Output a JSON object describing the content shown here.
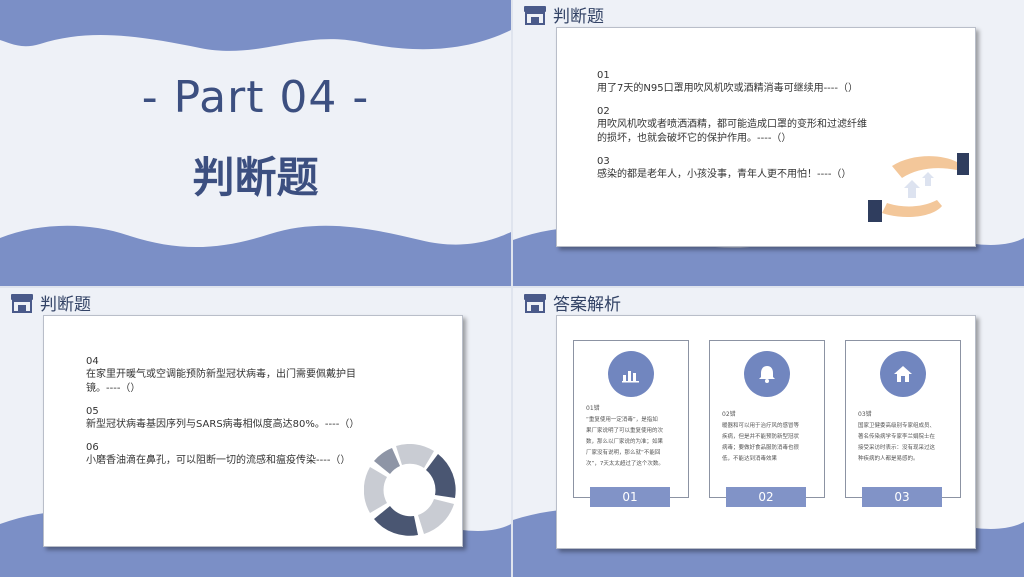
{
  "slide1": {
    "part": "- Part 04 -",
    "title": "判断题"
  },
  "slide2": {
    "header": "判断题",
    "items": [
      {
        "num": "01",
        "text": "用了7天的N95口罩用吹风机吹或酒精消毒可继续用----（）"
      },
      {
        "num": "02",
        "text": "用吹风机吹或者喷洒酒精，都可能造成口罩的变形和过滤纤维",
        "text2": "的损坏，也就会破坏它的保护作用。----（）"
      },
      {
        "num": "03",
        "text": "感染的都是老年人，小孩没事，青年人更不用怕！----（）"
      }
    ]
  },
  "slide3": {
    "header": "判断题",
    "items": [
      {
        "num": "04",
        "text": "在家里开暖气或空调能预防新型冠状病毒，出门需要佩戴护目",
        "text2": "镜。----（）"
      },
      {
        "num": "05",
        "text": "新型冠状病毒基因序列与SARS病毒相似度高达80%。----（）"
      },
      {
        "num": "06",
        "text": "小磨香油滴在鼻孔，可以阻断一切的流感和瘟疫传染----（）"
      }
    ]
  },
  "slide4": {
    "header": "答案解析",
    "columns": [
      {
        "label": "01错",
        "lines": [
          "“重复使用一定消毒”，是指如",
          "果厂家说明了可以重复使用的次",
          "数，那么以厂家说的为准；如果",
          "厂家没有说明，那么就“不能回",
          "次”，7天太太超过了这个次数。"
        ],
        "button": "01"
      },
      {
        "label": "02错",
        "lines": [
          "暖器和可以用于治疗风的感冒等",
          "疾病，但是并不能预防新型冠状",
          "病毒；要做好食品服防消毒也很",
          "低，不能达到消毒效果"
        ],
        "button": "02"
      },
      {
        "label": "03错",
        "lines": [
          "国家卫健委高级别专家组成员、",
          "著名传染病学专家李兰娟院士在",
          "接受采访时表示：没有现采过这",
          "种疾病的人都是易感的。"
        ],
        "button": "03"
      }
    ]
  },
  "colors": {
    "accent": "#7186bf",
    "dark": "#3c4f80",
    "wave": "#7b8fc6"
  }
}
